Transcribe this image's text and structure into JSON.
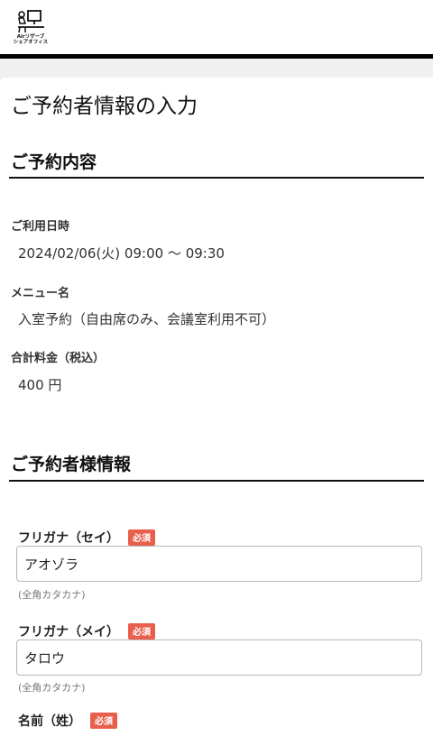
{
  "header": {
    "logo_line1": "Airリザーブ",
    "logo_line2": "シェアオフィス"
  },
  "page_title": "ご予約者情報の入力",
  "reservation": {
    "section_title": "ご予約内容",
    "datetime_label": "ご利用日時",
    "datetime_value": "2024/02/06(火) 09:00 〜 09:30",
    "menu_label": "メニュー名",
    "menu_value": "入室予約（自由席のみ、会議室利用不可）",
    "price_label": "合計料金（税込）",
    "price_value": "400 円"
  },
  "customer": {
    "section_title": "ご予約者様情報",
    "required_badge": "必須",
    "furigana_sei": {
      "label": "フリガナ（セイ）",
      "value": "アオゾラ",
      "hint": "(全角カタカナ)"
    },
    "furigana_mei": {
      "label": "フリガナ（メイ）",
      "value": "タロウ",
      "hint": "(全角カタカナ)"
    },
    "name_sei": {
      "label": "名前（姓）"
    }
  }
}
